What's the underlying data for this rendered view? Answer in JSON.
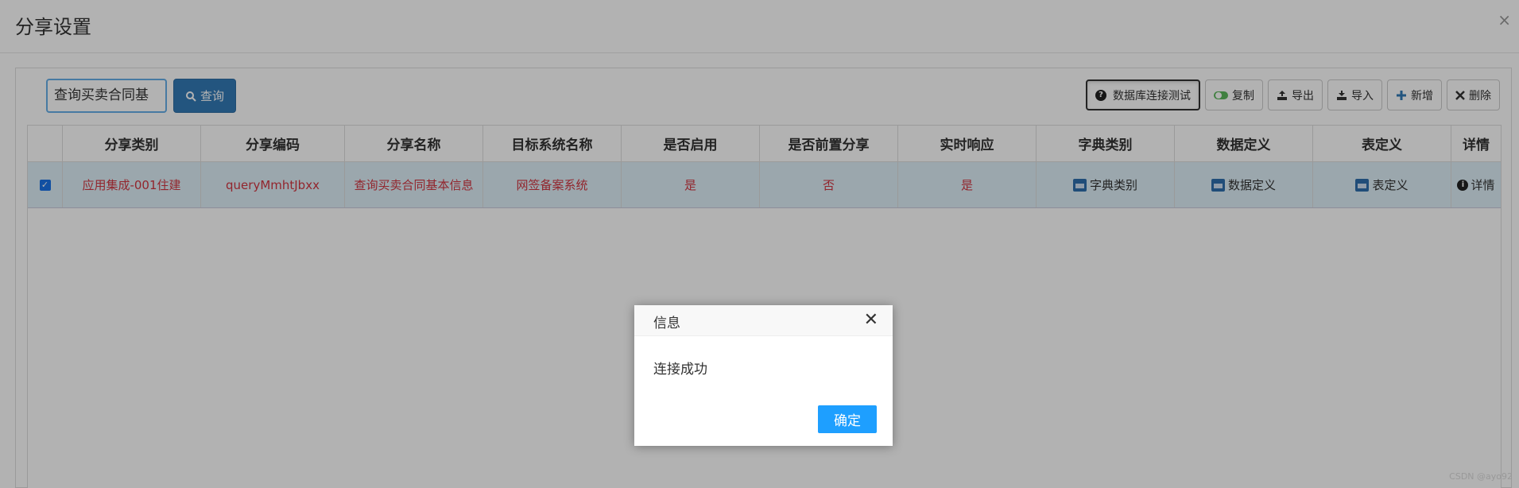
{
  "modal": {
    "title": "分享设置",
    "close_glyph": "×"
  },
  "search": {
    "value": "查询买卖合同基",
    "button": "查询"
  },
  "toolbar": {
    "db_test": "数据库连接测试",
    "copy": "复制",
    "export": "导出",
    "import": "导入",
    "add": "新增",
    "delete": "删除"
  },
  "table": {
    "headers": [
      "分享类别",
      "分享编码",
      "分享名称",
      "目标系统名称",
      "是否启用",
      "是否前置分享",
      "实时响应",
      "字典类别",
      "数据定义",
      "表定义",
      "详情"
    ],
    "rows": [
      {
        "checked": true,
        "category": "应用集成-001住建",
        "code": "queryMmhtJbxx",
        "name": "查询买卖合同基本信息",
        "target": "网签备案系统",
        "enabled": "是",
        "pre_share": "否",
        "realtime": "是",
        "dict": "字典类别",
        "datadef": "数据定义",
        "tabledef": "表定义",
        "detail": "详情"
      }
    ]
  },
  "dialog": {
    "title": "信息",
    "message": "连接成功",
    "ok": "确定",
    "close_glyph": "✕"
  },
  "watermark": "CSDN @ayo92"
}
